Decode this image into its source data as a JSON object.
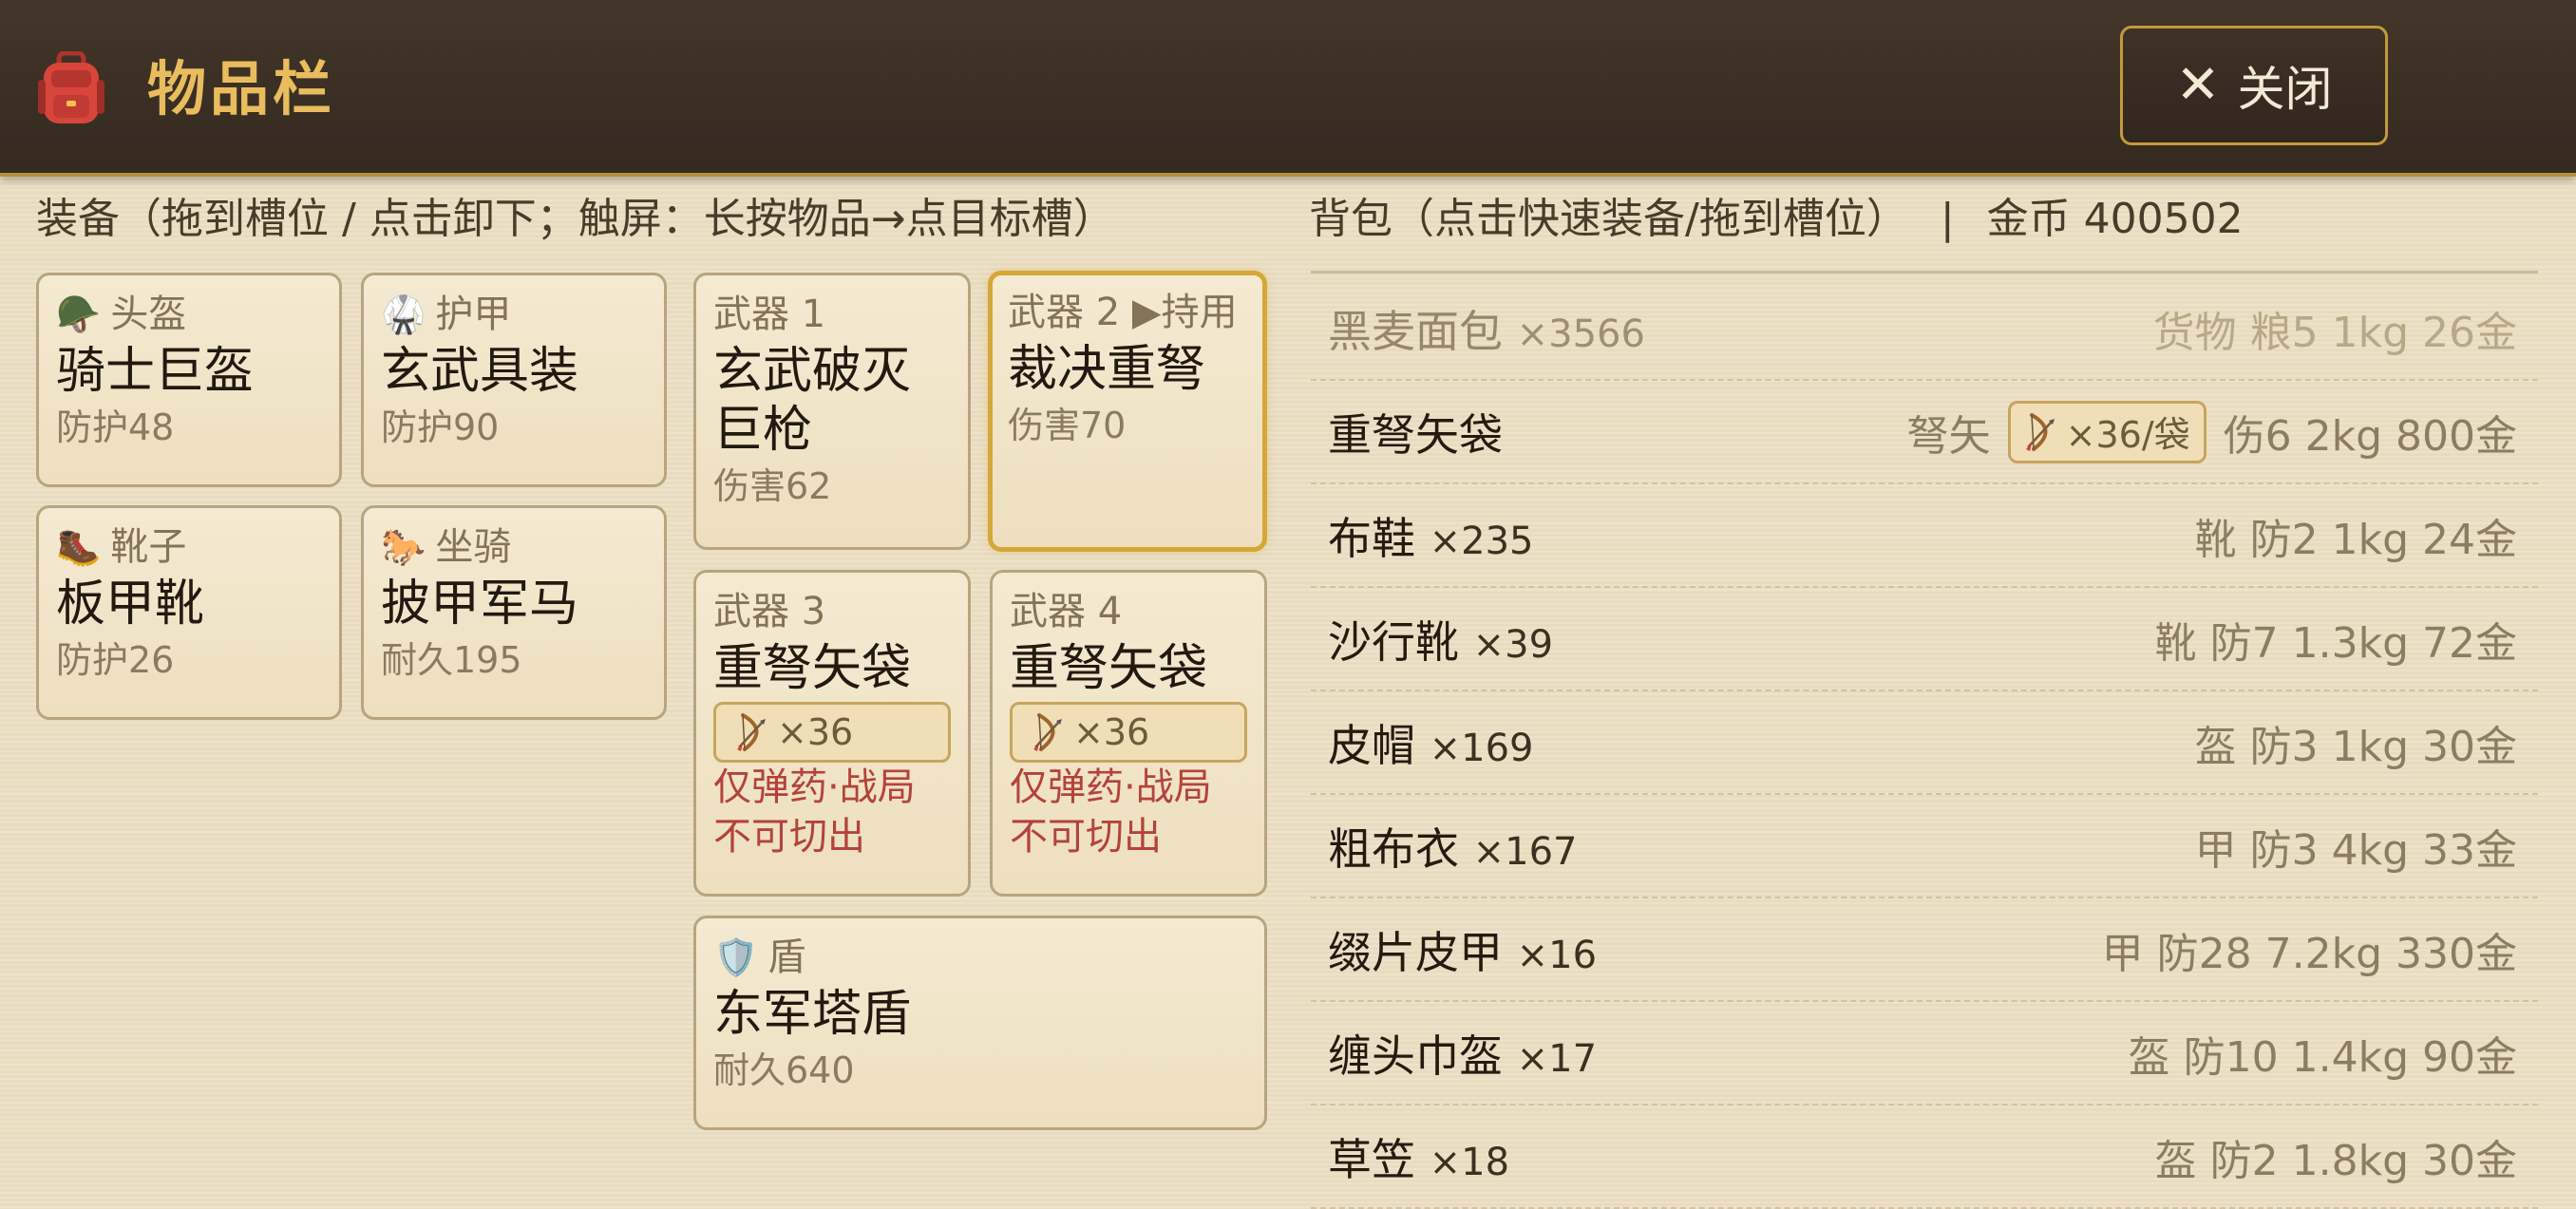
{
  "header": {
    "icon": "backpack-icon",
    "title": "物品栏",
    "close_label": "关闭",
    "close_icon": "close-icon"
  },
  "equipment": {
    "label": "装备（拖到槽位 / 点击卸下；触屏：长按物品→点目标槽）",
    "slots": [
      {
        "id": "helmet",
        "icon": "helmet-icon",
        "label": "头盔",
        "item": "骑士巨盔",
        "stat": "防护48"
      },
      {
        "id": "armor",
        "icon": "martial-arts-uniform-icon",
        "label": "护甲",
        "item": "玄武具装",
        "stat": "防护90"
      },
      {
        "id": "boots",
        "icon": "boot-icon",
        "label": "靴子",
        "item": "板甲靴",
        "stat": "防护26"
      },
      {
        "id": "mount",
        "icon": "horse-icon",
        "label": "坐骑",
        "item": "披甲军马",
        "stat": "耐久195"
      },
      {
        "id": "weapon1",
        "label": "武器 1",
        "item": "玄武破灭巨枪",
        "stat": "伤害62"
      },
      {
        "id": "weapon2",
        "label": "武器 2 ▶持用",
        "item": "裁决重弩",
        "stat": "伤害70",
        "active": true
      },
      {
        "id": "weapon3",
        "label": "武器 3",
        "item": "重弩矢袋",
        "ammo": "×36",
        "ammo_icon": "bow-icon",
        "warn": "仅弹药·战局不可切出"
      },
      {
        "id": "weapon4",
        "label": "武器 4",
        "item": "重弩矢袋",
        "ammo": "×36",
        "ammo_icon": "bow-icon",
        "warn": "仅弹药·战局不可切出"
      },
      {
        "id": "shield",
        "icon": "shield-icon",
        "label": "盾",
        "item": "东军塔盾",
        "stat": "耐久640"
      }
    ]
  },
  "inventory": {
    "label": "背包（点击快速装备/拖到槽位）",
    "separator": "|",
    "gold_label": "金币 400502",
    "items": [
      {
        "name": "黑麦面包",
        "count": "×3566",
        "meta": "货物 粮5 1kg 26金",
        "faded": true
      },
      {
        "name": "重弩矢袋",
        "count": "",
        "type": "弩矢",
        "tag": "×36/袋",
        "tag_icon": "bow-icon",
        "meta": "伤6 2kg 800金"
      },
      {
        "name": "布鞋",
        "count": "×235",
        "meta": "靴 防2 1kg 24金"
      },
      {
        "name": "沙行靴",
        "count": "×39",
        "meta": "靴 防7 1.3kg 72金"
      },
      {
        "name": "皮帽",
        "count": "×169",
        "meta": "盔 防3 1kg 30金"
      },
      {
        "name": "粗布衣",
        "count": "×167",
        "meta": "甲 防3 4kg 33金"
      },
      {
        "name": "缀片皮甲",
        "count": "×16",
        "meta": "甲 防28 7.2kg 330金"
      },
      {
        "name": "缠头巾盔",
        "count": "×17",
        "meta": "盔 防10 1.4kg 90金"
      },
      {
        "name": "草笠",
        "count": "×18",
        "meta": "盔 防2 1.8kg 30金"
      }
    ]
  },
  "colors": {
    "header_bg": "#3a2e23",
    "accent_gold": "#e9bd5e",
    "warning_red": "#b3433a",
    "panel_bg": "#ece0c4"
  }
}
